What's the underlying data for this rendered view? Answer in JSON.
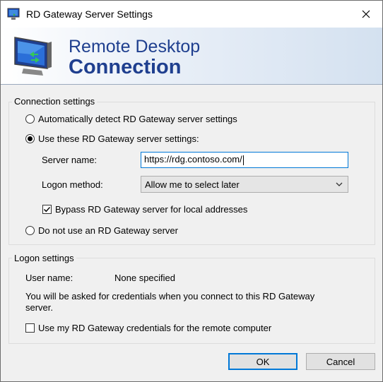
{
  "window": {
    "title": "RD Gateway Server Settings",
    "close_glyph": "✕"
  },
  "banner": {
    "line1": "Remote Desktop",
    "line2": "Connection"
  },
  "connection_settings": {
    "legend": "Connection settings",
    "auto_detect_label": "Automatically detect RD Gateway server settings",
    "use_these_label": "Use these RD Gateway server settings:",
    "server_name_label": "Server name:",
    "server_name_value": "https://rdg.contoso.com/",
    "logon_method_label": "Logon method:",
    "logon_method_value": "Allow me to select later",
    "bypass_label": "Bypass RD Gateway server for local addresses",
    "bypass_checked": true,
    "do_not_use_label": "Do not use an RD Gateway server",
    "selected_option": "use_these"
  },
  "logon_settings": {
    "legend": "Logon settings",
    "user_name_label": "User name:",
    "user_name_value": "None specified",
    "info_text_line1": "You will be asked for credentials when you connect to this RD Gateway",
    "info_text_line2": "server.",
    "use_credentials_label": "Use my RD Gateway credentials for the remote computer",
    "use_credentials_checked": false
  },
  "buttons": {
    "ok": "OK",
    "cancel": "Cancel"
  },
  "colors": {
    "accent": "#0078d7",
    "banner_text": "#1f3f8f"
  }
}
